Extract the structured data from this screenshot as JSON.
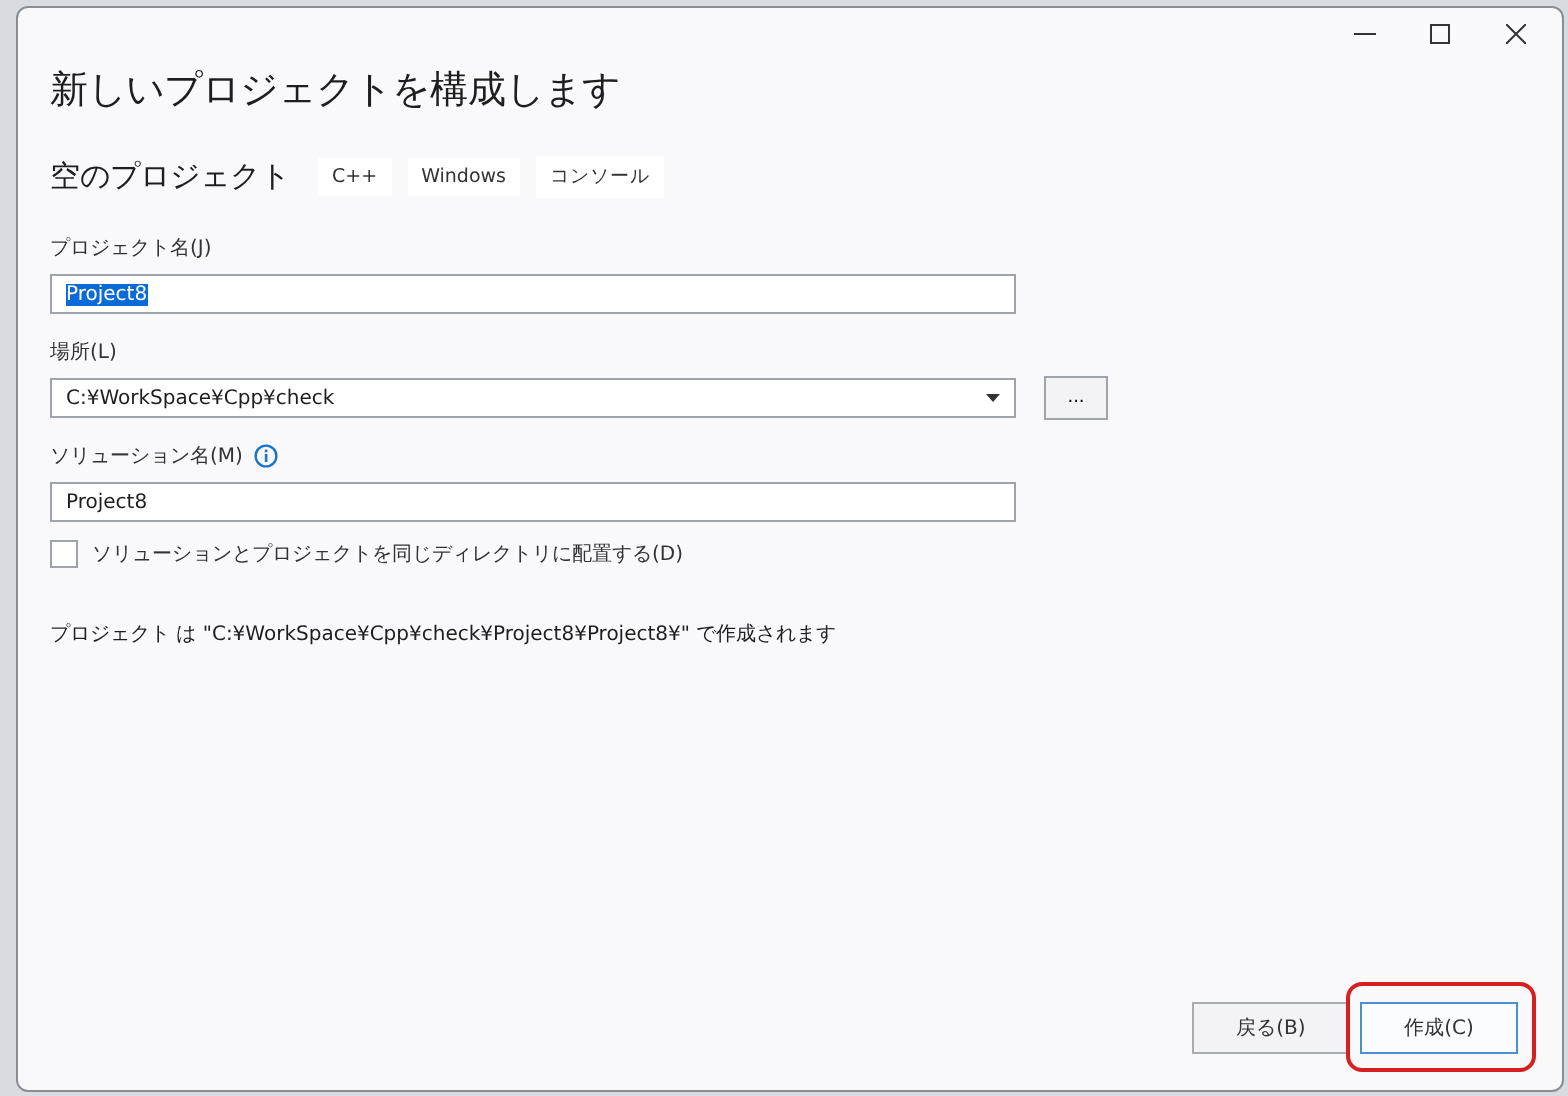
{
  "window": {
    "title": "新しいプロジェクトを構成します",
    "controls": [
      {
        "kind": "minimize"
      },
      {
        "kind": "maximize"
      },
      {
        "kind": "close"
      }
    ]
  },
  "template": {
    "name": "空のプロジェクト",
    "tags": [
      "C++",
      "Windows",
      "コンソール"
    ]
  },
  "project_name": {
    "label": "プロジェクト名(J)",
    "value": "Project8",
    "text_selected": true
  },
  "location": {
    "label": "場所(L)",
    "value": "C:¥WorkSpace¥Cpp¥check",
    "browse_button": "..."
  },
  "solution_name": {
    "label": "ソリューション名(M)",
    "value": "Project8"
  },
  "same_directory": {
    "label": "ソリューションとプロジェクトを同じディレクトリに配置する(D)",
    "checked": false
  },
  "info_text": "プロジェクト は \"C:¥WorkSpace¥Cpp¥check¥Project8¥Project8¥\" で作成されます",
  "buttons": [
    {
      "label": "戻る(B)",
      "focused": false,
      "highlighted": false
    },
    {
      "label": "作成(C)",
      "focused": true,
      "highlighted": true
    }
  ]
}
